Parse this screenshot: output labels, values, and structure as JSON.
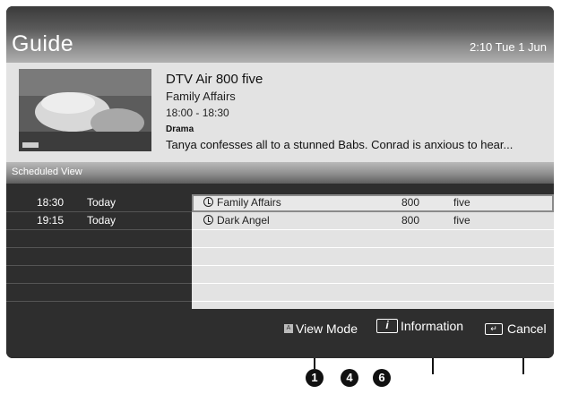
{
  "header": {
    "title": "Guide",
    "clock": "2:10 Tue 1 Jun"
  },
  "details": {
    "channel": "DTV Air 800 five",
    "programme": "Family Affairs",
    "time": "18:00 - 18:30",
    "genre": "Drama",
    "description": "Tanya confesses all to a stunned Babs. Conrad is anxious to hear..."
  },
  "section": {
    "label": "Scheduled View"
  },
  "schedule": [
    {
      "time": "18:30",
      "day": "Today",
      "programme": "Family Affairs",
      "channel_num": "800",
      "channel_name": "five"
    },
    {
      "time": "19:15",
      "day": "Today",
      "programme": "Dark Angel",
      "channel_num": "800",
      "channel_name": "five"
    }
  ],
  "footer": {
    "view_mode_key": "A",
    "view_mode": "View Mode",
    "info_key": "i",
    "information": "Information",
    "cancel_key": "↵",
    "cancel": "Cancel"
  },
  "callouts": [
    "1",
    "4",
    "6"
  ],
  "icons": [
    "clock-icon",
    "info-key-icon",
    "return-key-icon"
  ],
  "colors": {
    "panel": "#2e2e2e",
    "light_panel": "#e3e3e3"
  }
}
